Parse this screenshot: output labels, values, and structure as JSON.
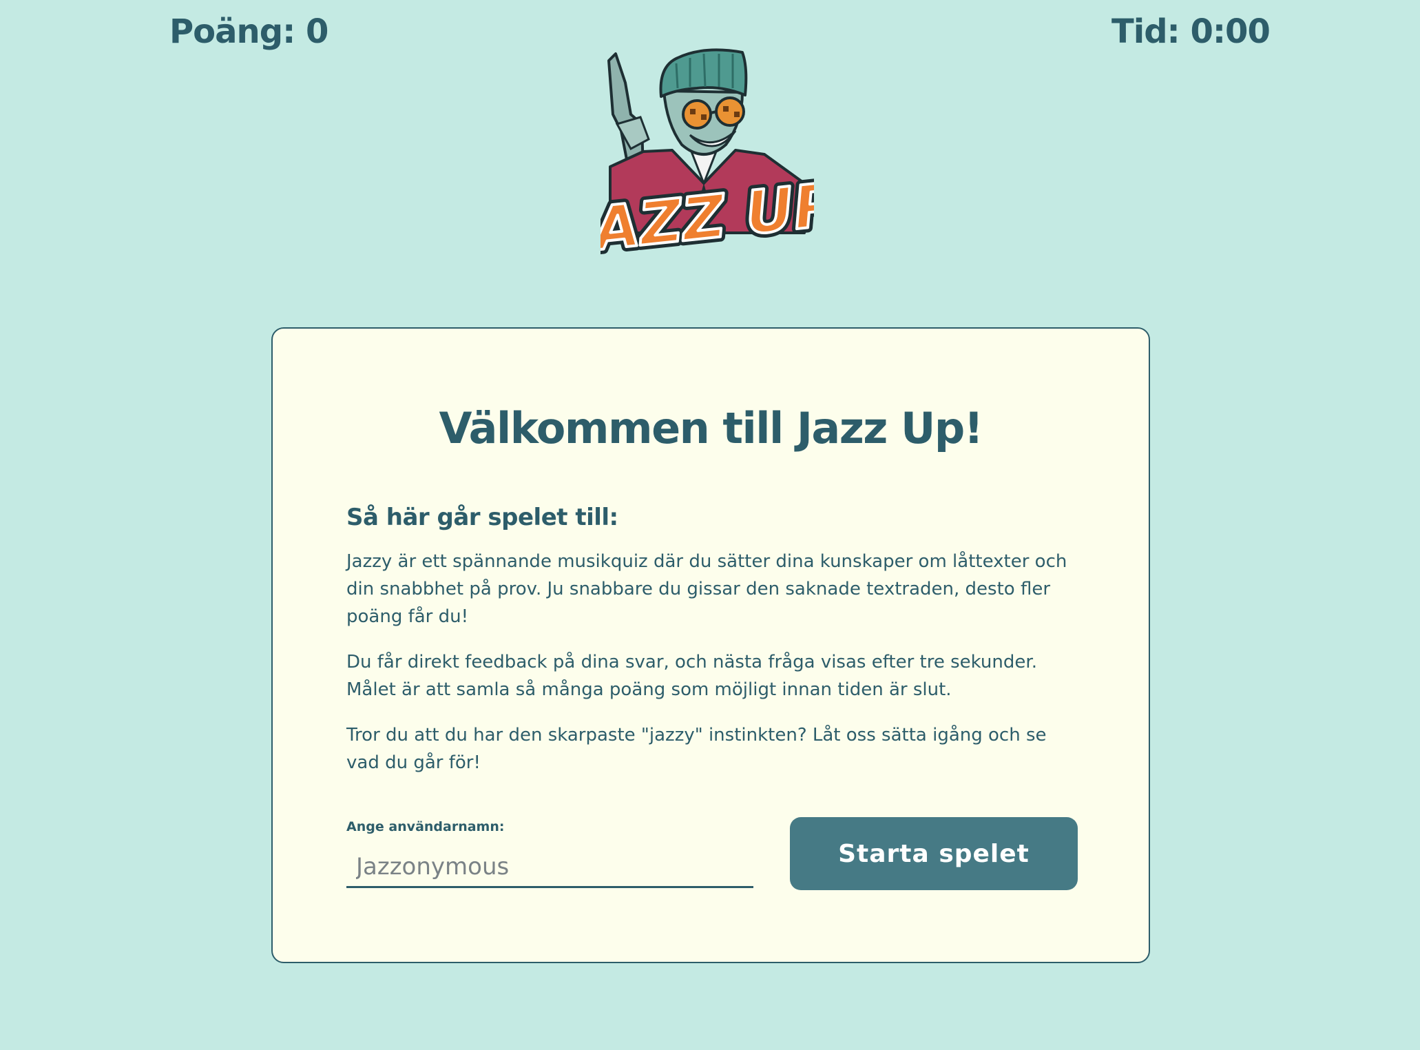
{
  "header": {
    "score": "Poäng: 0",
    "time": "Tid: 0:00"
  },
  "logo": {
    "text": "JAZZ UP",
    "icon": "jazz-mascot-logo"
  },
  "card": {
    "title": "Välkommen till Jazz Up!",
    "subtitle": "Så här går spelet till:",
    "paragraphs": [
      "Jazzy är ett spännande musikquiz där du sätter dina kunskaper om låttexter och din snabbhet på prov. Ju snabbare du gissar den saknade textraden, desto fler poäng får du!",
      "Du får direkt feedback på dina svar, och nästa fråga visas efter tre sekunder. Målet är att samla så många poäng som möjligt innan tiden är slut.",
      "Tror du att du har den skarpaste \"jazzy\" instinkten? Låt oss sätta igång och se vad du går för!"
    ],
    "username_label": "Ange användarnamn:",
    "username_placeholder": "Jazzonymous",
    "username_value": "",
    "start_button": "Starta spelet"
  },
  "colors": {
    "background": "#c4eae3",
    "card": "#fdfeec",
    "text": "#2d5d6a",
    "button": "#467a85"
  }
}
